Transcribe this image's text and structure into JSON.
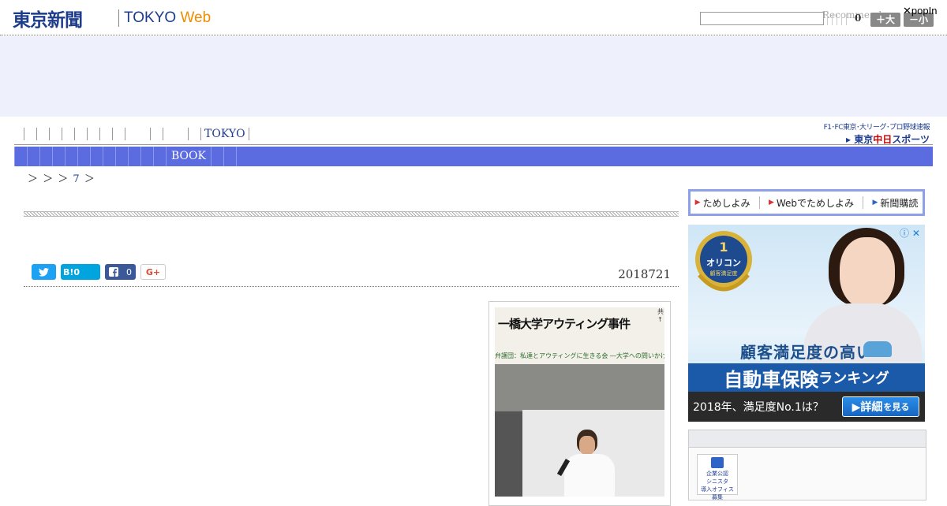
{
  "header": {
    "logo_jp": "東京新聞",
    "logo_en_main": "TOKYO ",
    "logo_en_web": "Web",
    "search_placeholder": "",
    "recommend_label": "Recommend",
    "recommend_count": "0",
    "font_large_label": "＋大",
    "font_small_label": "－小",
    "popin_label": "✕popIn"
  },
  "sub_nav": {
    "tokyo_label": "TOKYO"
  },
  "chunichi": {
    "top_line": "F1･FC東京･大リーグ･プロ野球速報",
    "bottom_prefix": "▸ 東京",
    "bottom_red": "中日",
    "bottom_suffix": "スポーツ"
  },
  "main_nav": {
    "book_label": "BOOK"
  },
  "breadcrumb": {
    "prefix": "＞ ＞ ＞",
    "link": "7",
    "suffix": "＞"
  },
  "share": {
    "twitter_icon": "twitter-icon",
    "hatena_label": "B!0",
    "facebook_count": "0",
    "google_label": "G+"
  },
  "article": {
    "date": "2018721"
  },
  "photo": {
    "banner_text": "一橋大学アウティング事件",
    "banner_sub": "弁護団：私達とアウティングに生きる会 ―大学への問いかけ―",
    "banner_corner": "共↑"
  },
  "tameshi": {
    "item1": "ためしよみ",
    "item2": "Webでためしよみ",
    "item3": "新聞購読"
  },
  "ad": {
    "info_icons": "ⓘ ✕",
    "medal_rank": "1",
    "medal_brand": "オリコン",
    "medal_sub": "顧客満足度",
    "headline": "顧客満足度の高い",
    "title_main": "自動車保険",
    "title_small": "ランキング",
    "bottom_text": "2018年、満足度No.1は？",
    "cta_main": "▶詳細",
    "cta_small": "を見る"
  },
  "side_badge": {
    "line1": "企業公認",
    "line2": "シニスタ",
    "line3": "導入オフィス",
    "line4": "募集"
  },
  "colors": {
    "brand_navy": "#1d3c8c",
    "brand_orange": "#f08c00",
    "nav_blue": "#5b6be0",
    "ad_band": "#eef1fc"
  }
}
